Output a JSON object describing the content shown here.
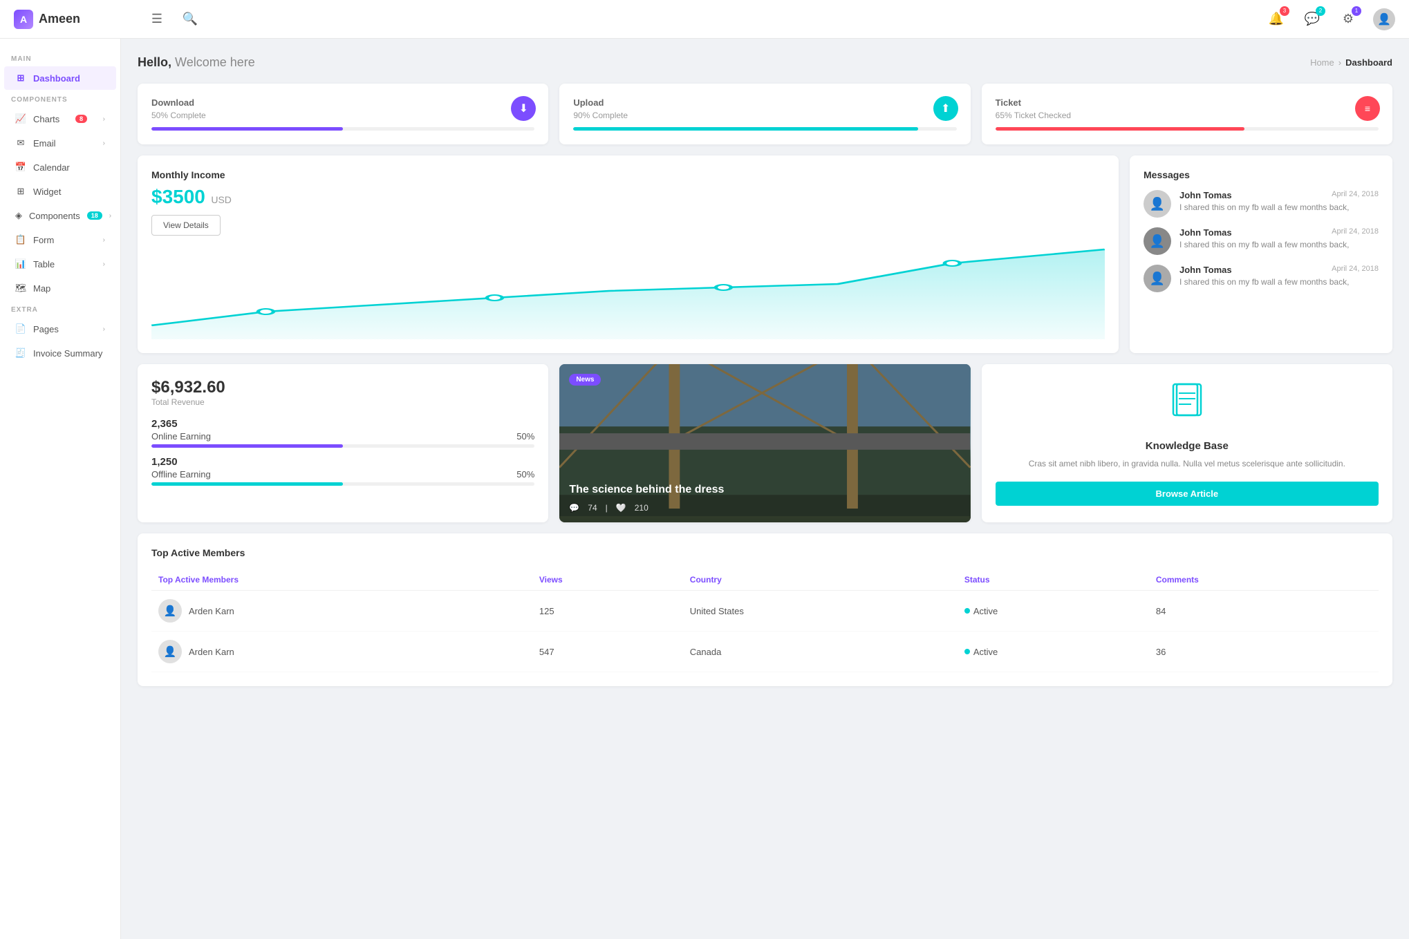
{
  "app": {
    "name": "Ameen"
  },
  "topbar": {
    "menu_icon": "☰",
    "search_icon": "🔍",
    "notification_badge": "3",
    "chat_badge": "2",
    "settings_badge": "1"
  },
  "sidebar": {
    "main_label": "MAIN",
    "components_label": "COMPONENTS",
    "extra_label": "EXTRA",
    "items": [
      {
        "id": "dashboard",
        "label": "Dashboard",
        "icon": "⊞",
        "active": true
      },
      {
        "id": "charts",
        "label": "Charts",
        "icon": "📈",
        "badge": "8",
        "badge_color": "red",
        "has_chevron": true
      },
      {
        "id": "email",
        "label": "Email",
        "icon": "✉",
        "has_chevron": true
      },
      {
        "id": "calendar",
        "label": "Calendar",
        "icon": "📅"
      },
      {
        "id": "widget",
        "label": "Widget",
        "icon": "⊞"
      },
      {
        "id": "components",
        "label": "Components",
        "icon": "◈",
        "badge": "18",
        "badge_color": "teal",
        "has_chevron": true
      },
      {
        "id": "form",
        "label": "Form",
        "icon": "📋",
        "has_chevron": true
      },
      {
        "id": "table",
        "label": "Table",
        "icon": "📊",
        "has_chevron": true
      },
      {
        "id": "map",
        "label": "Map",
        "icon": "🗺"
      },
      {
        "id": "pages",
        "label": "Pages",
        "icon": "📄",
        "has_chevron": true
      },
      {
        "id": "invoice",
        "label": "Invoice Summary",
        "icon": "🧾"
      }
    ]
  },
  "page": {
    "greeting": "Hello,",
    "greeting_sub": "Welcome here",
    "breadcrumb_home": "Home",
    "breadcrumb_current": "Dashboard"
  },
  "stat_cards": [
    {
      "title": "Download",
      "value": "50% Complete",
      "progress": 50,
      "icon": "⬇",
      "icon_class": "icon-purple",
      "bar_class": "pb-purple"
    },
    {
      "title": "Upload",
      "value": "90% Complete",
      "progress": 90,
      "icon": "⬆",
      "icon_class": "icon-teal",
      "bar_class": "pb-teal"
    },
    {
      "title": "Ticket",
      "value": "65% Ticket Checked",
      "progress": 65,
      "icon": "≡",
      "icon_class": "icon-red",
      "bar_class": "pb-red"
    }
  ],
  "monthly_income": {
    "title": "Monthly Income",
    "amount": "$3500",
    "currency": "USD",
    "view_details": "View Details"
  },
  "messages": {
    "title": "Messages",
    "items": [
      {
        "name": "John Tomas",
        "date": "April 24, 2018",
        "text": "I shared this on my fb wall a few months back,"
      },
      {
        "name": "John Tomas",
        "date": "April 24, 2018",
        "text": "I shared this on my fb wall a few months back,"
      },
      {
        "name": "John Tomas",
        "date": "April 24, 2018",
        "text": "I shared this on my fb wall a few months back,"
      }
    ]
  },
  "revenue": {
    "amount": "$6,932.60",
    "label": "Total Revenue",
    "online_count": "2,365",
    "online_label": "Online Earning",
    "online_pct": "50%",
    "online_progress": 50,
    "offline_count": "1,250",
    "offline_label": "Offline Earning",
    "offline_pct": "50%",
    "offline_progress": 50
  },
  "news": {
    "badge": "News",
    "headline": "The science behind the dress",
    "comments": "74",
    "likes": "210"
  },
  "knowledge_base": {
    "title": "Knowledge Base",
    "text": "Cras sit amet nibh libero, in gravida nulla. Nulla vel metus scelerisque ante sollicitudin.",
    "button": "Browse Article"
  },
  "table": {
    "title": "Top Active Members",
    "columns": [
      "Top Active Members",
      "Views",
      "Country",
      "Status",
      "Comments"
    ],
    "rows": [
      {
        "name": "Arden Karn",
        "views": "125",
        "country": "United States",
        "status": "Active",
        "comments": "84"
      },
      {
        "name": "Arden Karn",
        "views": "547",
        "country": "Canada",
        "status": "Active",
        "comments": "36"
      }
    ]
  }
}
